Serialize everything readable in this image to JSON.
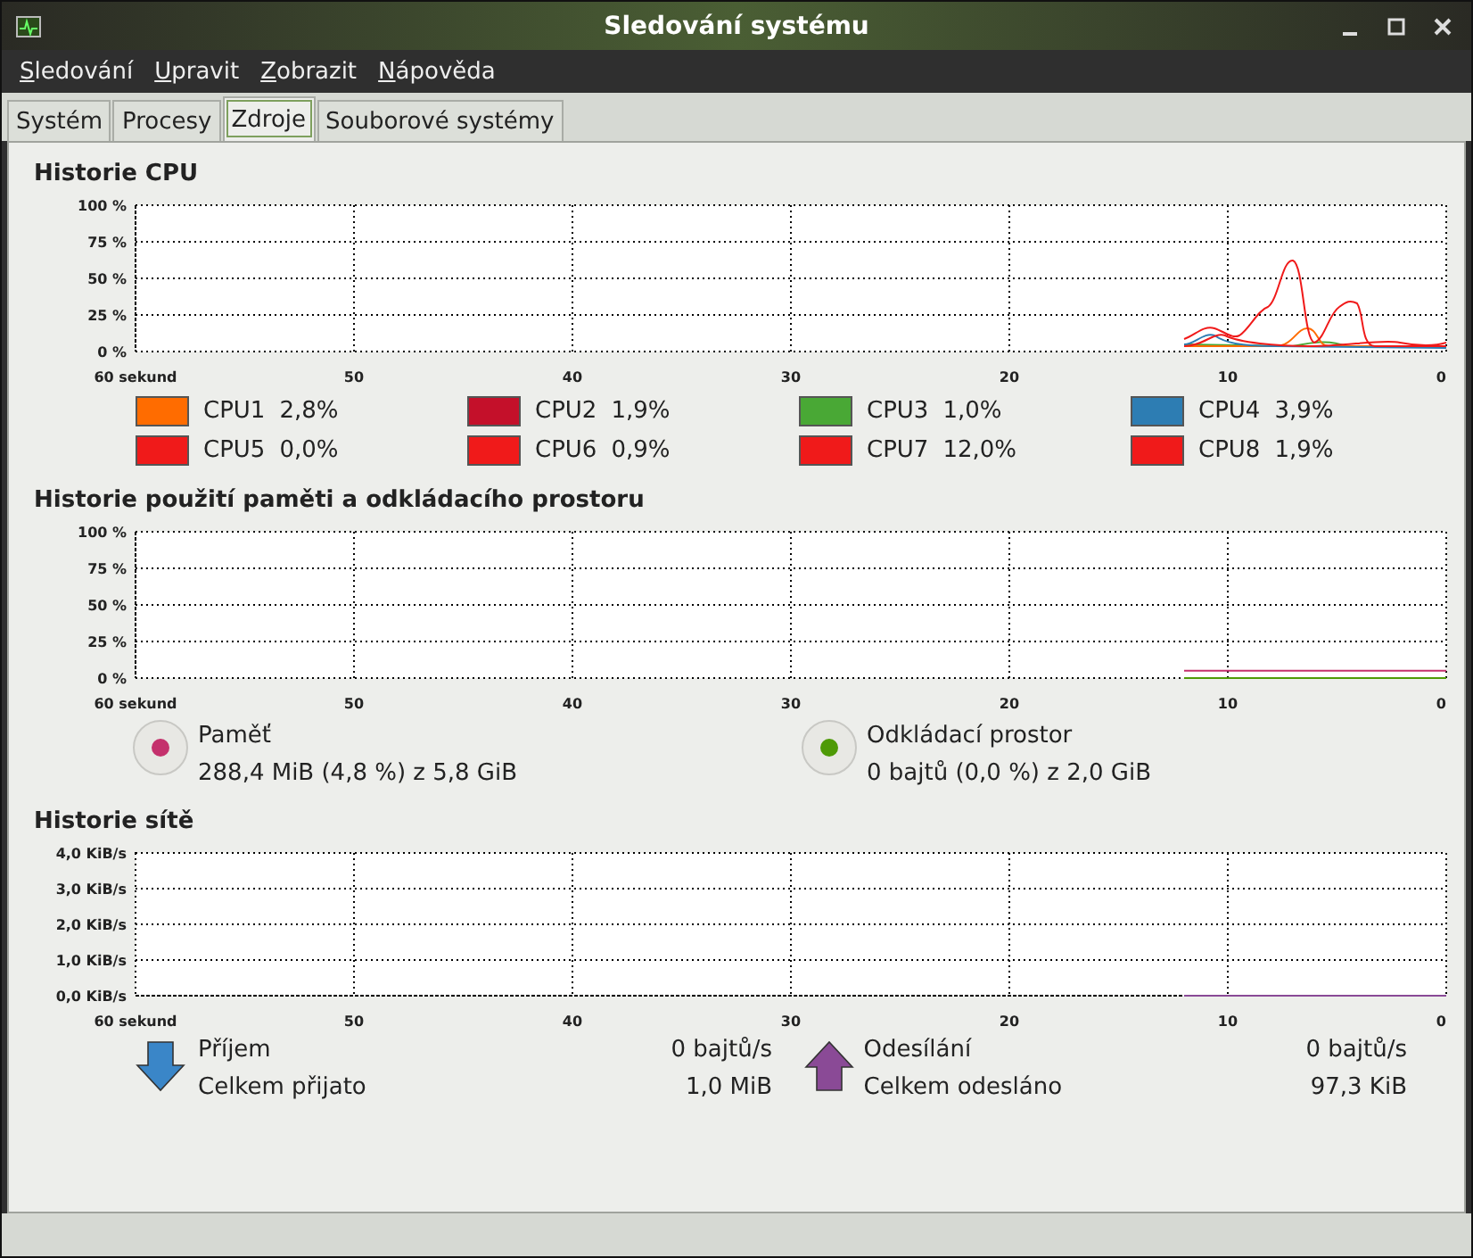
{
  "window": {
    "title": "Sledování systému"
  },
  "menu": [
    "Sledování",
    "Upravit",
    "Zobrazit",
    "Nápověda"
  ],
  "tabs": [
    {
      "label": "Systém",
      "selected": false
    },
    {
      "label": "Procesy",
      "selected": false
    },
    {
      "label": "Zdroje",
      "selected": true
    },
    {
      "label": "Souborové systémy",
      "selected": false
    }
  ],
  "cpu": {
    "title": "Historie CPU",
    "y_labels": [
      "100 %",
      "75 %",
      "50 %",
      "25 %",
      "0 %"
    ],
    "x_labels": [
      "60 sekund",
      "50",
      "40",
      "30",
      "20",
      "10",
      "0"
    ],
    "legend": [
      {
        "name": "CPU1",
        "reading": "2,8%",
        "color": "#ff6c00"
      },
      {
        "name": "CPU2",
        "reading": "1,9%",
        "color": "#c4102a"
      },
      {
        "name": "CPU3",
        "reading": "1,0%",
        "color": "#49a835"
      },
      {
        "name": "CPU4",
        "reading": "3,9%",
        "color": "#2d7db3"
      },
      {
        "name": "CPU5",
        "reading": "0,0%",
        "color": "#f01a1a"
      },
      {
        "name": "CPU6",
        "reading": "0,9%",
        "color": "#f01a1a"
      },
      {
        "name": "CPU7",
        "reading": "12,0%",
        "color": "#f01a1a"
      },
      {
        "name": "CPU8",
        "reading": "1,9%",
        "color": "#f01a1a"
      }
    ]
  },
  "memory": {
    "title": "Historie použití paměti a odkládacího prostoru",
    "chart_data": {
      "type": "line",
      "grid": true,
      "x": [
        12,
        0
      ],
      "xlim": [
        60,
        0
      ],
      "ylim": [
        0,
        100
      ],
      "xticks": [
        {
          "value": 60,
          "label": "60 sekund"
        },
        {
          "value": 50,
          "label": "50"
        },
        {
          "value": 40,
          "label": "40"
        },
        {
          "value": 30,
          "label": "30"
        },
        {
          "value": 20,
          "label": "20"
        },
        {
          "value": 10,
          "label": "10"
        },
        {
          "value": 0,
          "label": "0"
        }
      ],
      "yticks": [
        {
          "value": 100,
          "label": "100 %"
        },
        {
          "value": 75,
          "label": "75 %"
        },
        {
          "value": 50,
          "label": "50 %"
        },
        {
          "value": 25,
          "label": "25 %"
        },
        {
          "value": 0,
          "label": "0 %"
        }
      ],
      "series": [
        {
          "name": "Paměť",
          "color": "#c4316c",
          "values": [
            5,
            5
          ]
        },
        {
          "name": "Odkládací prostor",
          "color": "#4e9a06",
          "values": [
            0,
            0
          ]
        }
      ]
    },
    "items": [
      {
        "detail": "288,4 MiB (4,8 %) z 5,8 GiB"
      },
      {
        "detail": "0 bajtů (0,0 %) z 2,0 GiB"
      }
    ]
  },
  "network": {
    "title": "Historie sítě",
    "chart_data": {
      "type": "line",
      "grid": true,
      "x": [
        12,
        0
      ],
      "xlim": [
        60,
        0
      ],
      "ylim": [
        0,
        4
      ],
      "xticks": [
        {
          "value": 60,
          "label": "60 sekund"
        },
        {
          "value": 50,
          "label": "50"
        },
        {
          "value": 40,
          "label": "40"
        },
        {
          "value": 30,
          "label": "30"
        },
        {
          "value": 20,
          "label": "20"
        },
        {
          "value": 10,
          "label": "10"
        },
        {
          "value": 0,
          "label": "0"
        }
      ],
      "yticks": [
        {
          "value": 4,
          "label": "4,0 KiB/s"
        },
        {
          "value": 3,
          "label": "3,0 KiB/s"
        },
        {
          "value": 2,
          "label": "2,0 KiB/s"
        },
        {
          "value": 1,
          "label": "1,0 KiB/s"
        },
        {
          "value": 0,
          "label": "0,0 KiB/s"
        }
      ],
      "series": [
        {
          "name": "Příjem",
          "color": "#3a86c8",
          "values": [
            null,
            null
          ]
        },
        {
          "name": "Odesílání",
          "color": "#8a4a96",
          "values": [
            0,
            0
          ]
        }
      ]
    },
    "items": [
      {
        "kind": "download",
        "rate": "0 bajtů/s",
        "total_label": "Celkem přijato",
        "total": "1,0 MiB"
      },
      {
        "kind": "upload",
        "rate": "0 bajtů/s",
        "total_label": "Celkem odesláno",
        "total": "97,3 KiB"
      }
    ]
  }
}
